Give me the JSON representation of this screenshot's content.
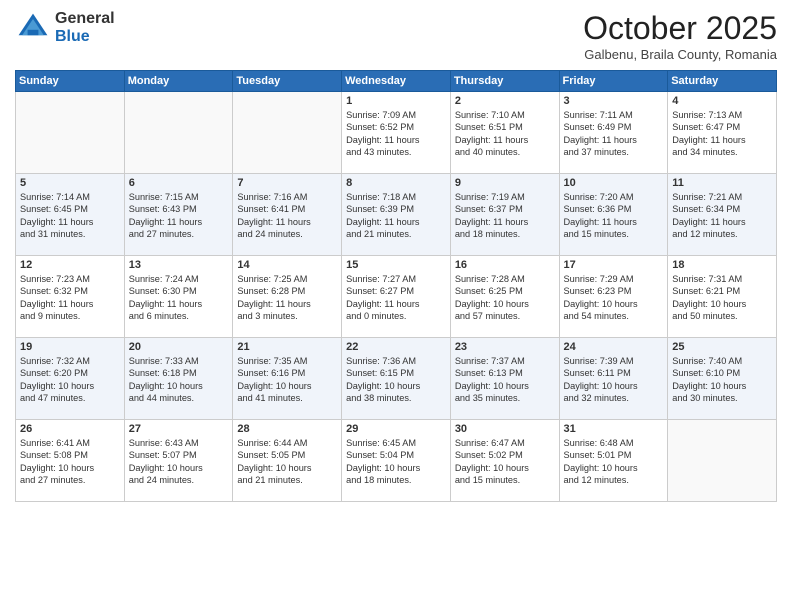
{
  "logo": {
    "general": "General",
    "blue": "Blue"
  },
  "header": {
    "month": "October 2025",
    "location": "Galbenu, Braila County, Romania"
  },
  "weekdays": [
    "Sunday",
    "Monday",
    "Tuesday",
    "Wednesday",
    "Thursday",
    "Friday",
    "Saturday"
  ],
  "weeks": [
    [
      {
        "day": "",
        "info": ""
      },
      {
        "day": "",
        "info": ""
      },
      {
        "day": "",
        "info": ""
      },
      {
        "day": "1",
        "info": "Sunrise: 7:09 AM\nSunset: 6:52 PM\nDaylight: 11 hours\nand 43 minutes."
      },
      {
        "day": "2",
        "info": "Sunrise: 7:10 AM\nSunset: 6:51 PM\nDaylight: 11 hours\nand 40 minutes."
      },
      {
        "day": "3",
        "info": "Sunrise: 7:11 AM\nSunset: 6:49 PM\nDaylight: 11 hours\nand 37 minutes."
      },
      {
        "day": "4",
        "info": "Sunrise: 7:13 AM\nSunset: 6:47 PM\nDaylight: 11 hours\nand 34 minutes."
      }
    ],
    [
      {
        "day": "5",
        "info": "Sunrise: 7:14 AM\nSunset: 6:45 PM\nDaylight: 11 hours\nand 31 minutes."
      },
      {
        "day": "6",
        "info": "Sunrise: 7:15 AM\nSunset: 6:43 PM\nDaylight: 11 hours\nand 27 minutes."
      },
      {
        "day": "7",
        "info": "Sunrise: 7:16 AM\nSunset: 6:41 PM\nDaylight: 11 hours\nand 24 minutes."
      },
      {
        "day": "8",
        "info": "Sunrise: 7:18 AM\nSunset: 6:39 PM\nDaylight: 11 hours\nand 21 minutes."
      },
      {
        "day": "9",
        "info": "Sunrise: 7:19 AM\nSunset: 6:37 PM\nDaylight: 11 hours\nand 18 minutes."
      },
      {
        "day": "10",
        "info": "Sunrise: 7:20 AM\nSunset: 6:36 PM\nDaylight: 11 hours\nand 15 minutes."
      },
      {
        "day": "11",
        "info": "Sunrise: 7:21 AM\nSunset: 6:34 PM\nDaylight: 11 hours\nand 12 minutes."
      }
    ],
    [
      {
        "day": "12",
        "info": "Sunrise: 7:23 AM\nSunset: 6:32 PM\nDaylight: 11 hours\nand 9 minutes."
      },
      {
        "day": "13",
        "info": "Sunrise: 7:24 AM\nSunset: 6:30 PM\nDaylight: 11 hours\nand 6 minutes."
      },
      {
        "day": "14",
        "info": "Sunrise: 7:25 AM\nSunset: 6:28 PM\nDaylight: 11 hours\nand 3 minutes."
      },
      {
        "day": "15",
        "info": "Sunrise: 7:27 AM\nSunset: 6:27 PM\nDaylight: 11 hours\nand 0 minutes."
      },
      {
        "day": "16",
        "info": "Sunrise: 7:28 AM\nSunset: 6:25 PM\nDaylight: 10 hours\nand 57 minutes."
      },
      {
        "day": "17",
        "info": "Sunrise: 7:29 AM\nSunset: 6:23 PM\nDaylight: 10 hours\nand 54 minutes."
      },
      {
        "day": "18",
        "info": "Sunrise: 7:31 AM\nSunset: 6:21 PM\nDaylight: 10 hours\nand 50 minutes."
      }
    ],
    [
      {
        "day": "19",
        "info": "Sunrise: 7:32 AM\nSunset: 6:20 PM\nDaylight: 10 hours\nand 47 minutes."
      },
      {
        "day": "20",
        "info": "Sunrise: 7:33 AM\nSunset: 6:18 PM\nDaylight: 10 hours\nand 44 minutes."
      },
      {
        "day": "21",
        "info": "Sunrise: 7:35 AM\nSunset: 6:16 PM\nDaylight: 10 hours\nand 41 minutes."
      },
      {
        "day": "22",
        "info": "Sunrise: 7:36 AM\nSunset: 6:15 PM\nDaylight: 10 hours\nand 38 minutes."
      },
      {
        "day": "23",
        "info": "Sunrise: 7:37 AM\nSunset: 6:13 PM\nDaylight: 10 hours\nand 35 minutes."
      },
      {
        "day": "24",
        "info": "Sunrise: 7:39 AM\nSunset: 6:11 PM\nDaylight: 10 hours\nand 32 minutes."
      },
      {
        "day": "25",
        "info": "Sunrise: 7:40 AM\nSunset: 6:10 PM\nDaylight: 10 hours\nand 30 minutes."
      }
    ],
    [
      {
        "day": "26",
        "info": "Sunrise: 6:41 AM\nSunset: 5:08 PM\nDaylight: 10 hours\nand 27 minutes."
      },
      {
        "day": "27",
        "info": "Sunrise: 6:43 AM\nSunset: 5:07 PM\nDaylight: 10 hours\nand 24 minutes."
      },
      {
        "day": "28",
        "info": "Sunrise: 6:44 AM\nSunset: 5:05 PM\nDaylight: 10 hours\nand 21 minutes."
      },
      {
        "day": "29",
        "info": "Sunrise: 6:45 AM\nSunset: 5:04 PM\nDaylight: 10 hours\nand 18 minutes."
      },
      {
        "day": "30",
        "info": "Sunrise: 6:47 AM\nSunset: 5:02 PM\nDaylight: 10 hours\nand 15 minutes."
      },
      {
        "day": "31",
        "info": "Sunrise: 6:48 AM\nSunset: 5:01 PM\nDaylight: 10 hours\nand 12 minutes."
      },
      {
        "day": "",
        "info": ""
      }
    ]
  ]
}
